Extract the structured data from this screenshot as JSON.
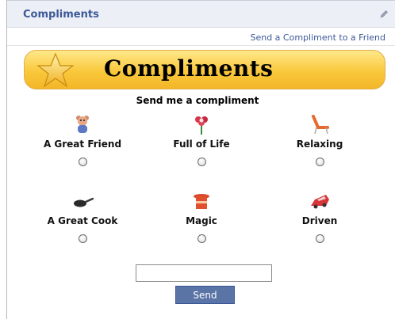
{
  "header": {
    "title": "Compliments"
  },
  "send_link": "Send a Compliment to a Friend",
  "banner": {
    "title": "Compliments"
  },
  "subtitle": "Send me a compliment",
  "options": [
    {
      "label": "A Great Friend",
      "icon": "teddy-bear-icon"
    },
    {
      "label": "Full of Life",
      "icon": "flower-icon"
    },
    {
      "label": "Relaxing",
      "icon": "lounge-chair-icon"
    },
    {
      "label": "A Great Cook",
      "icon": "frying-pan-icon"
    },
    {
      "label": "Magic",
      "icon": "magic-hat-icon"
    },
    {
      "label": "Driven",
      "icon": "red-car-icon"
    }
  ],
  "input": {
    "value": "",
    "placeholder": ""
  },
  "send_button": "Send",
  "colors": {
    "link": "#3b5998",
    "button": "#5a74a6",
    "banner": "#f9c83b"
  }
}
